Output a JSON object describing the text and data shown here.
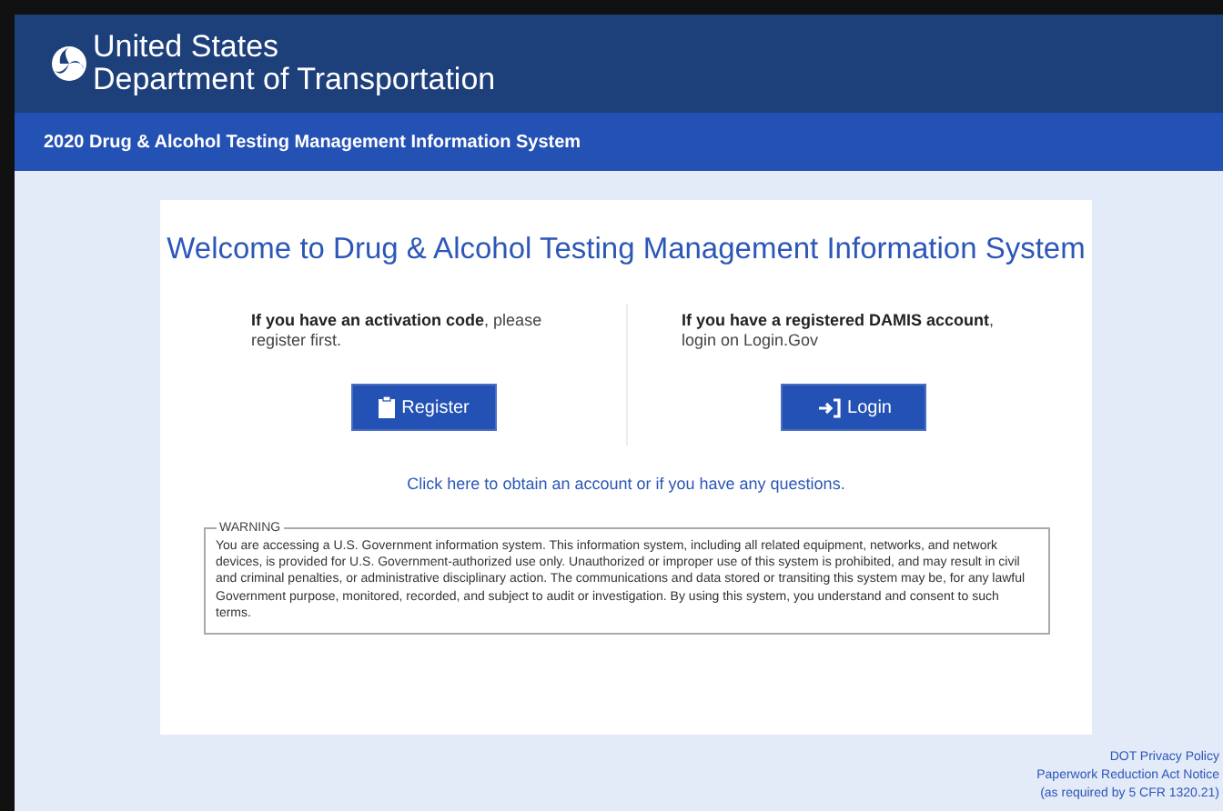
{
  "header": {
    "agency_line_1": "United States",
    "agency_line_2": "Department of Transportation",
    "system_bar": "2020 Drug & Alcohol Testing Management Information System"
  },
  "card": {
    "title": "Welcome to Drug & Alcohol Testing Management Information System",
    "columns": [
      {
        "kind": "register",
        "text": "**If you have an activation code**, please register first.",
        "button": "Register"
      },
      {
        "kind": "login",
        "text": "**If you have a registered DAMIS account**, login on Login.Gov",
        "button": "Login"
      }
    ],
    "help_link": "Click here to obtain an account or if you have any questions.",
    "warning": {
      "legend": "WARNING",
      "text": "You are accessing a U.S. Government information system. This information system, including all related equipment, networks, and network devices, is provided for U.S. Government-authorized use only. Unauthorized or improper use of this system is prohibited, and may result in civil and criminal penalties, or administrative disciplinary action. The communications and data stored or transiting this system may be, for any lawful Government purpose, monitored, recorded, and subject to audit or investigation. By using this system, you understand and consent to such terms."
    }
  },
  "footer": {
    "links": [
      "DOT Privacy Policy",
      "Paperwork Reduction Act Notice"
    ],
    "note": "(as required by 5 CFR 1320.21)"
  }
}
